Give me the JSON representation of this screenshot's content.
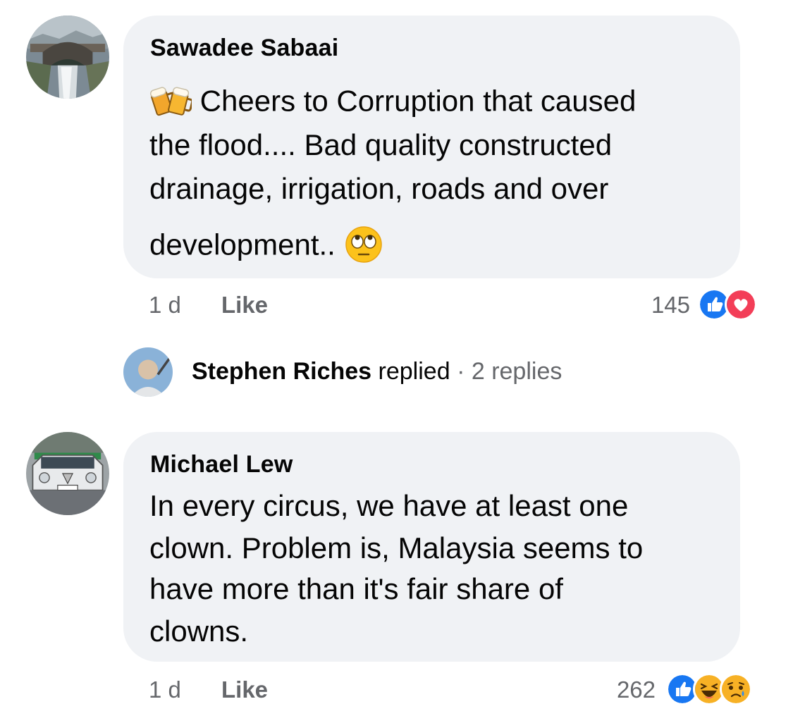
{
  "comments": [
    {
      "author": "Sawadee Sabaai",
      "lines": [
        "Cheers to Corruption that caused",
        "the flood.... Bad quality constructed",
        "drainage, irrigation, roads and over",
        "development.."
      ],
      "leading_emoji": "beer-mugs-icon",
      "trailing_emoji": "eye-roll-icon",
      "time": "1 d",
      "like_label": "Like",
      "reaction_count": "145",
      "reactions": [
        "like-reaction-icon",
        "love-reaction-icon"
      ]
    },
    {
      "author": "Michael Lew",
      "lines": [
        "In every circus, we have at least one",
        "clown. Problem is, Malaysia seems to",
        "have more than it's fair share of",
        "clowns."
      ],
      "time": "1 d",
      "like_label": "Like",
      "reaction_count": "262",
      "reactions": [
        "like-reaction-icon",
        "haha-reaction-icon",
        "sad-reaction-icon"
      ]
    }
  ],
  "reply": {
    "replier": "Stephen Riches",
    "verb": "replied",
    "separator": "·",
    "replies": "2 replies"
  },
  "colors": {
    "bubble": "#f0f2f5",
    "secondary_text": "#65676b",
    "like_blue": "#1877f2",
    "love_red": "#f33e58",
    "haha_yellow": "#f7b125"
  }
}
